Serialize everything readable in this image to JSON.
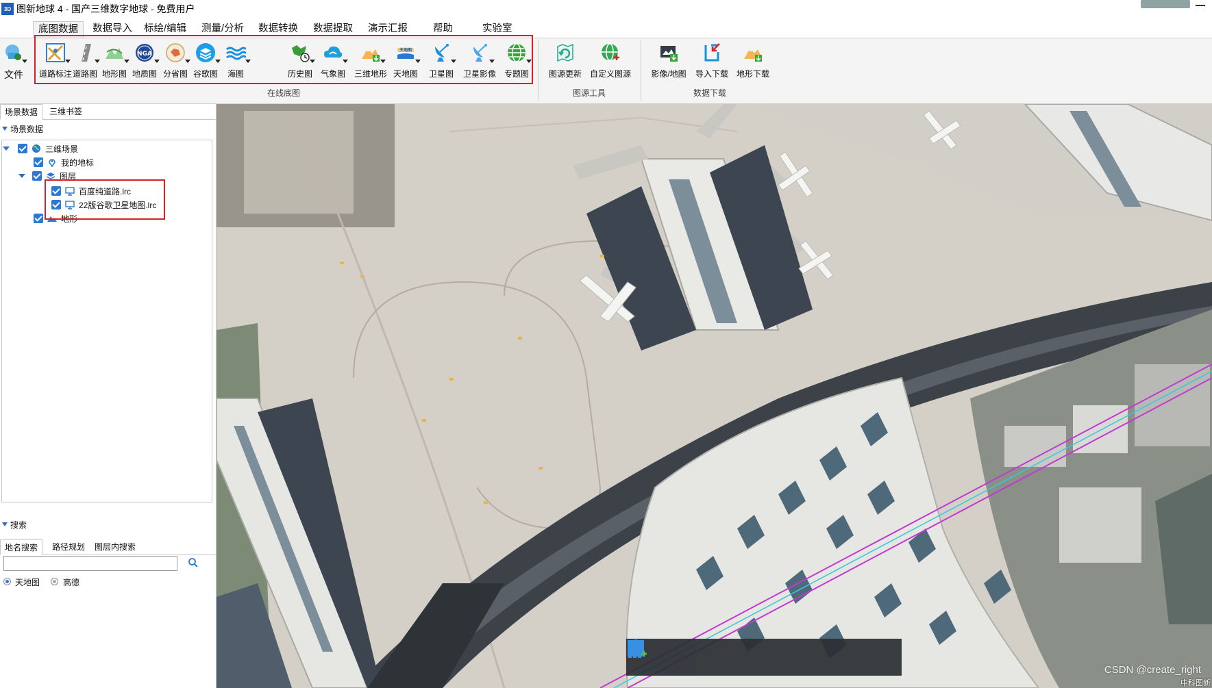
{
  "window": {
    "title": "图新地球 4 - 国产三维数字地球 - 免费用户",
    "app_icon": "earth-app-icon"
  },
  "menu": {
    "tabs": [
      "底图数据",
      "数据导入",
      "标绘/编辑",
      "测量/分析",
      "数据转换",
      "数据提取",
      "演示汇报",
      "帮助",
      "实验室"
    ],
    "active": "底图数据"
  },
  "ribbon": {
    "file_label": "文件",
    "online_basemaps": [
      {
        "label": "道路标注",
        "icon": "road-label-icon",
        "color": "#2e7fd6"
      },
      {
        "label": "道路图",
        "icon": "road-map-icon",
        "color": "#8a8a8a"
      },
      {
        "label": "地形图",
        "icon": "terrain-map-icon",
        "color": "#58a858"
      },
      {
        "label": "地质图",
        "icon": "geology-map-icon",
        "color": "#23489a"
      },
      {
        "label": "分省图",
        "icon": "province-map-icon",
        "color": "#c8a466"
      },
      {
        "label": "谷歌图",
        "icon": "google-map-icon",
        "color": "#1b9ee6"
      },
      {
        "label": "海图",
        "icon": "sea-chart-icon",
        "color": "#1b8fe0"
      },
      {
        "label": "历史图",
        "icon": "history-map-icon",
        "color": "#3a9c3a"
      },
      {
        "label": "气象图",
        "icon": "weather-map-icon",
        "color": "#1f9fd8"
      },
      {
        "label": "三维地形",
        "icon": "3d-terrain-icon",
        "color": "#e0a030"
      },
      {
        "label": "天地图",
        "icon": "tianditu-icon",
        "color": "#d9a21f"
      },
      {
        "label": "卫星图",
        "icon": "satellite-map-icon",
        "color": "#1d8fd8"
      },
      {
        "label": "卫星影像",
        "icon": "satellite-imagery-icon",
        "color": "#1d8fd8"
      },
      {
        "label": "专题图",
        "icon": "thematic-map-icon",
        "color": "#3aa53a"
      }
    ],
    "online_basemaps_group": "在线底图",
    "source_tools": [
      {
        "label": "图源更新",
        "icon": "source-update-icon",
        "color": "#2aa58a"
      },
      {
        "label": "自定义图源",
        "icon": "custom-source-icon",
        "color": "#34a853"
      }
    ],
    "source_tools_group": "图源工具",
    "downloads": [
      {
        "label": "影像/地图",
        "icon": "imagery-download-icon",
        "color": "#333b45"
      },
      {
        "label": "导入下载",
        "icon": "import-download-icon",
        "color": "#1d8fd8"
      },
      {
        "label": "地形下载",
        "icon": "terrain-download-icon",
        "color": "#e0a030"
      }
    ],
    "downloads_group": "数据下载"
  },
  "left_panel": {
    "tabs": [
      "场景数据",
      "三维书签"
    ],
    "active_tab": "场景数据",
    "section_title": "场景数据",
    "tree": {
      "root": "三维场景",
      "my_places": "我的地标",
      "layers": "图层",
      "layer_items": [
        "百度纯道路.lrc",
        "22版谷歌卫星地图.lrc"
      ],
      "terrain": "地形"
    },
    "search_section": "搜索",
    "search_tabs": [
      "地名搜索",
      "路径规划",
      "图层内搜索"
    ],
    "search_active": "地名搜索",
    "search_placeholder": "",
    "providers": [
      {
        "label": "天地图",
        "selected": true
      },
      {
        "label": "高德",
        "selected": false
      }
    ]
  },
  "map": {
    "watermark": "CSDN @create_right",
    "corner_text": "中科图新",
    "toolbar": [
      "hand-pan-icon",
      "select-arrow-icon",
      "place-marker-icon",
      "draw-line-icon",
      "draw-rectangle-icon",
      "add-chart-icon"
    ]
  },
  "colors": {
    "highlight_box": "#d6212b",
    "accent_blue": "#2a79d4"
  }
}
